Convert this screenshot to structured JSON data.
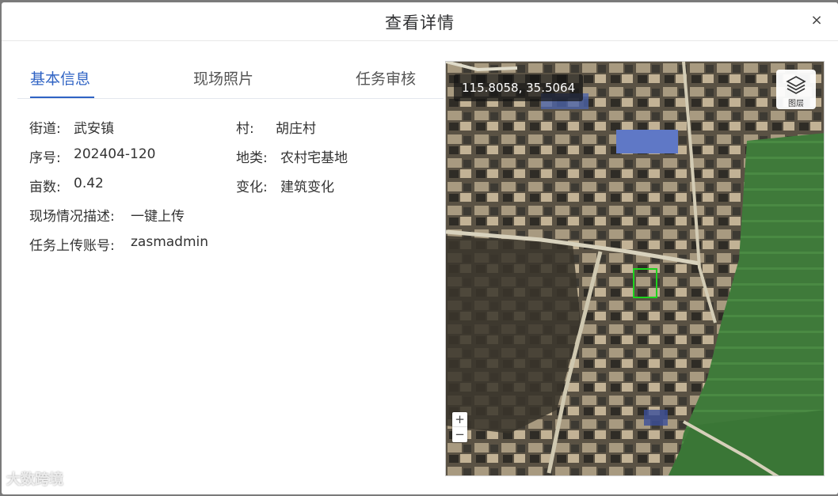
{
  "dialog": {
    "title": "查看详情",
    "close_glyph": "×"
  },
  "tabs": [
    {
      "label": "基本信息",
      "active": true
    },
    {
      "label": "现场照片",
      "active": false
    },
    {
      "label": "任务审核",
      "active": false
    }
  ],
  "info": {
    "street_label": "街道:",
    "street_value": "武安镇",
    "village_label": "村:",
    "village_value": "胡庄村",
    "serial_label": "序号:",
    "serial_value": "202404-120",
    "landtype_label": "地类:",
    "landtype_value": "农村宅基地",
    "mu_label": "亩数:",
    "mu_value": "0.42",
    "change_label": "变化:",
    "change_value": "建筑变化",
    "desc_label": "现场情况描述:",
    "desc_value": "一键上传",
    "account_label": "任务上传账号:",
    "account_value": "zasmadmin"
  },
  "map": {
    "coordinates": "115.8058, 35.5064",
    "layer_button_label": "图层",
    "layer_icon": "layers-icon",
    "zoom_in": "+",
    "zoom_out": "−",
    "highlight_color": "#1ed31e"
  },
  "watermark": {
    "text": "大数跨境"
  }
}
